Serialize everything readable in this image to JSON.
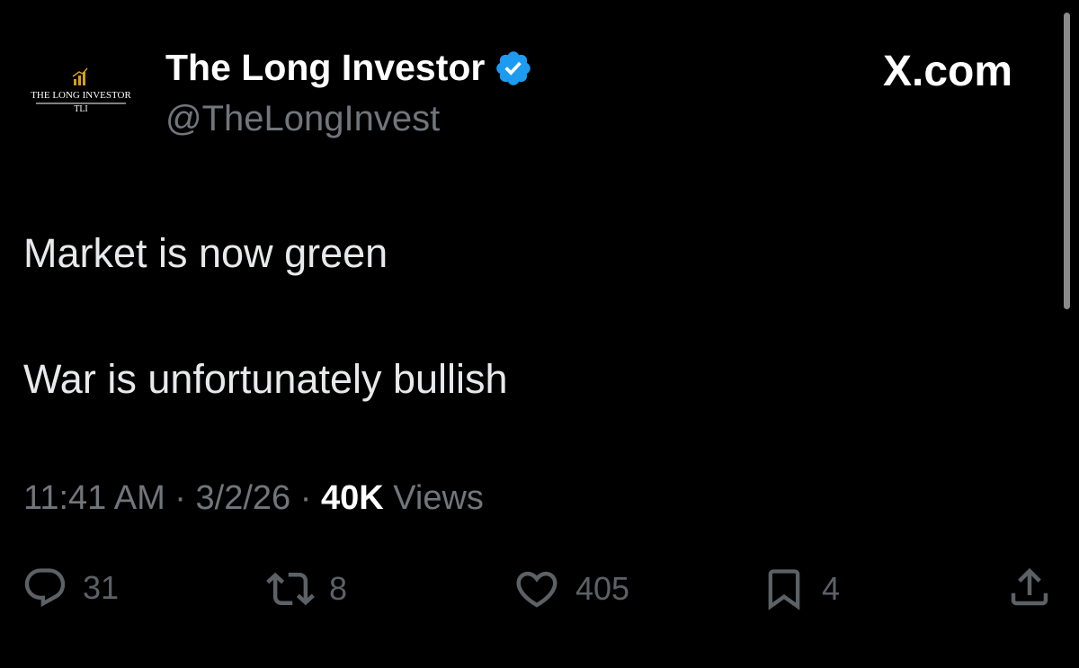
{
  "profile": {
    "avatar_line1": "THE LONG INVESTOR",
    "avatar_line2": "TLI",
    "display_name": "The Long Investor",
    "handle": "@TheLongInvest",
    "verified_icon": "verified-badge-icon"
  },
  "brand": "X.com",
  "tweet": {
    "line1": "Market is now green",
    "line2": "War is unfortunately bullish"
  },
  "meta": {
    "time": "11:41 AM",
    "separator": "·",
    "date": "3/2/26",
    "views_count": "40K",
    "views_label": "Views"
  },
  "actions": {
    "replies": "31",
    "reposts": "8",
    "likes": "405",
    "bookmarks": "4"
  },
  "colors": {
    "background": "#000000",
    "text": "#e7e9ea",
    "secondary": "#71767b",
    "verified": "#1d9bf0",
    "logo_gold": "#d4a017"
  }
}
